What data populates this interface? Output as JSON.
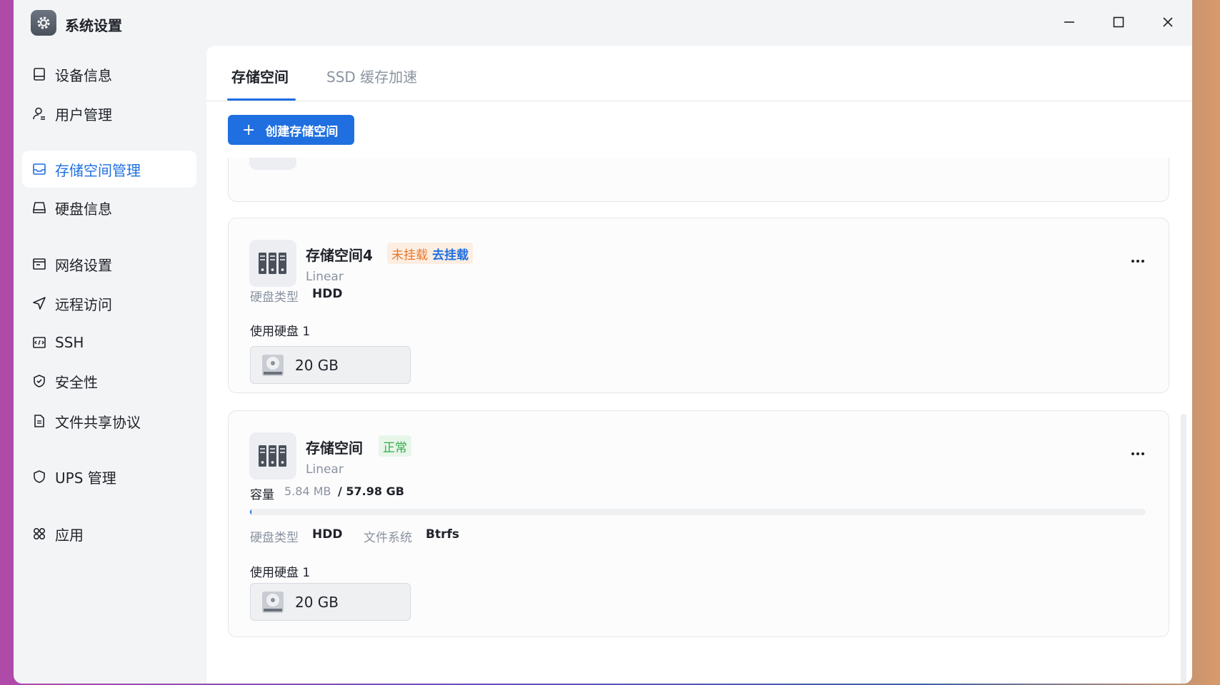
{
  "window": {
    "title": "系统设置",
    "icon": "gear-icon"
  },
  "sidebar": {
    "items": [
      {
        "label": "设备信息",
        "icon": "device-icon"
      },
      {
        "label": "用户管理",
        "icon": "user-icon"
      },
      {
        "label": "存储空间管理",
        "icon": "storage-icon",
        "active": true
      },
      {
        "label": "硬盘信息",
        "icon": "disk-icon"
      },
      {
        "label": "网络设置",
        "icon": "network-icon"
      },
      {
        "label": "远程访问",
        "icon": "send-icon"
      },
      {
        "label": "SSH",
        "icon": "terminal-icon"
      },
      {
        "label": "安全性",
        "icon": "shield-check-icon"
      },
      {
        "label": "文件共享协议",
        "icon": "document-icon"
      },
      {
        "label": "UPS 管理",
        "icon": "shield-icon"
      },
      {
        "label": "应用",
        "icon": "apps-icon"
      }
    ]
  },
  "tabs": [
    {
      "label": "存储空间",
      "active": true
    },
    {
      "label": "SSD 缓存加速"
    }
  ],
  "toolbar": {
    "create_label": "创建存储空间"
  },
  "accent_color": "#1f6fe0",
  "pools": [
    {
      "name": "存储空间4",
      "status": "未挂载",
      "action": "去挂载",
      "raid": "Linear",
      "disk_type_label": "硬盘类型",
      "disk_type": "HDD",
      "used_disks_label": "使用硬盘 1",
      "disk_size": "20 GB"
    },
    {
      "name": "存储空间",
      "status": "正常",
      "raid": "Linear",
      "capacity_label": "容量",
      "capacity_used": "5.84 MB",
      "capacity_total": "/ 57.98 GB",
      "usage_fraction": 0.0001,
      "disk_type_label": "硬盘类型",
      "disk_type": "HDD",
      "fs_label": "文件系统",
      "fs": "Btrfs",
      "used_disks_label": "使用硬盘 1",
      "disk_size": "20 GB"
    }
  ]
}
